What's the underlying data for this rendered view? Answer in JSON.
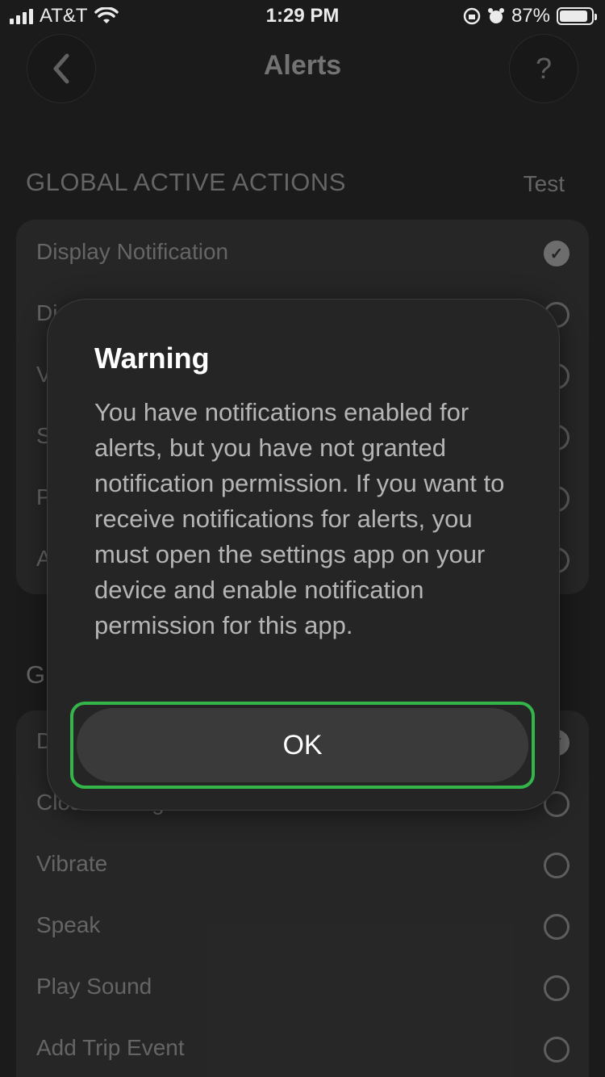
{
  "status_bar": {
    "carrier": "AT&T",
    "time": "1:29 PM",
    "battery": "87%"
  },
  "header": {
    "title": "Alerts",
    "back_icon": "chevron-left-icon",
    "help_label": "?"
  },
  "section1": {
    "title": "GLOBAL ACTIVE ACTIONS",
    "test_label": "Test",
    "items": [
      {
        "label": "Display Notification",
        "checked": true
      },
      {
        "label": "Di",
        "checked": false
      },
      {
        "label": "V",
        "checked": false
      },
      {
        "label": "S",
        "checked": false
      },
      {
        "label": "P",
        "checked": false
      },
      {
        "label": "A",
        "checked": false
      }
    ]
  },
  "section2": {
    "title": "G",
    "items": [
      {
        "label": "D",
        "checked": true
      },
      {
        "label": "Close Dialog",
        "checked": false
      },
      {
        "label": "Vibrate",
        "checked": false
      },
      {
        "label": "Speak",
        "checked": false
      },
      {
        "label": "Play Sound",
        "checked": false
      },
      {
        "label": "Add Trip Event",
        "checked": false
      }
    ]
  },
  "dialog": {
    "title": "Warning",
    "message": "You have notifications enabled for alerts, but you have not granted notification permission. If you want to receive notifications for alerts, you must open the settings app on your device and enable notification permission for this app.",
    "ok_label": "OK"
  },
  "colors": {
    "ok_highlight": "#33b54a",
    "background": "#1e1e1e",
    "card": "#2a2a2a"
  }
}
